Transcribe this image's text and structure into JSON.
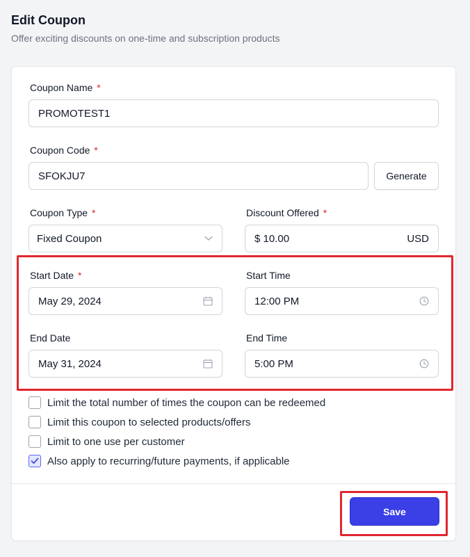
{
  "header": {
    "title": "Edit Coupon",
    "subtitle": "Offer exciting discounts on one-time and subscription products"
  },
  "form": {
    "coupon_name": {
      "label": "Coupon Name",
      "required_mark": "*",
      "value": "PROMOTEST1"
    },
    "coupon_code": {
      "label": "Coupon Code",
      "required_mark": "*",
      "value": "SFOKJU7",
      "generate_label": "Generate"
    },
    "coupon_type": {
      "label": "Coupon Type",
      "required_mark": "*",
      "selected": "Fixed Coupon"
    },
    "discount": {
      "label": "Discount Offered",
      "required_mark": "*",
      "value": "$ 10.00",
      "suffix": "USD"
    },
    "start_date": {
      "label": "Start Date",
      "required_mark": "*",
      "value": "May 29, 2024"
    },
    "start_time": {
      "label": "Start Time",
      "value": "12:00 PM"
    },
    "end_date": {
      "label": "End Date",
      "value": "May 31, 2024"
    },
    "end_time": {
      "label": "End Time",
      "value": "5:00 PM"
    }
  },
  "options": [
    {
      "label": "Limit the total number of times the coupon can be redeemed",
      "checked": false
    },
    {
      "label": "Limit this coupon to selected products/offers",
      "checked": false
    },
    {
      "label": "Limit to one use per customer",
      "checked": false
    },
    {
      "label": "Also apply to recurring/future payments, if applicable",
      "checked": true
    }
  ],
  "footer": {
    "save_label": "Save"
  },
  "colors": {
    "accent": "#3b3fe6",
    "highlight": "#e0262f",
    "required": "#dc2626"
  },
  "icons": {
    "select": "chevron-down-icon",
    "date": "calendar-icon",
    "time": "clock-icon",
    "check": "checkmark-icon"
  }
}
